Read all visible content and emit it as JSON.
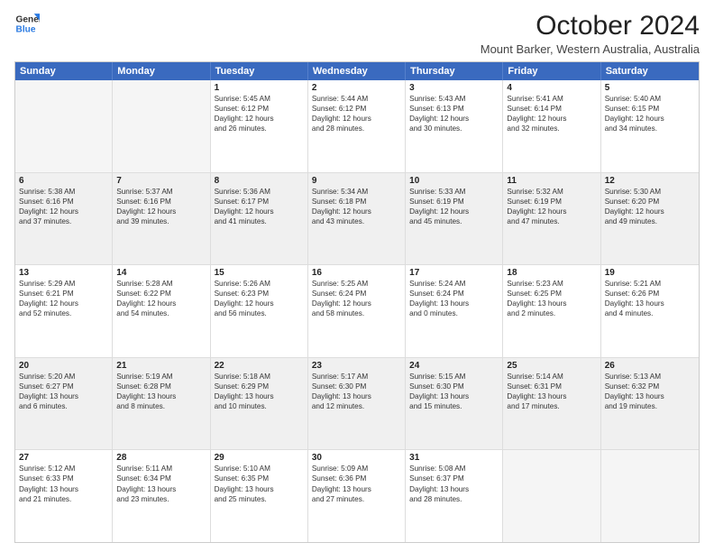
{
  "logo": {
    "line1": "General",
    "line2": "Blue"
  },
  "title": "October 2024",
  "subtitle": "Mount Barker, Western Australia, Australia",
  "headers": [
    "Sunday",
    "Monday",
    "Tuesday",
    "Wednesday",
    "Thursday",
    "Friday",
    "Saturday"
  ],
  "rows": [
    [
      {
        "day": "",
        "lines": [],
        "empty": true
      },
      {
        "day": "",
        "lines": [],
        "empty": true
      },
      {
        "day": "1",
        "lines": [
          "Sunrise: 5:45 AM",
          "Sunset: 6:12 PM",
          "Daylight: 12 hours",
          "and 26 minutes."
        ]
      },
      {
        "day": "2",
        "lines": [
          "Sunrise: 5:44 AM",
          "Sunset: 6:12 PM",
          "Daylight: 12 hours",
          "and 28 minutes."
        ]
      },
      {
        "day": "3",
        "lines": [
          "Sunrise: 5:43 AM",
          "Sunset: 6:13 PM",
          "Daylight: 12 hours",
          "and 30 minutes."
        ]
      },
      {
        "day": "4",
        "lines": [
          "Sunrise: 5:41 AM",
          "Sunset: 6:14 PM",
          "Daylight: 12 hours",
          "and 32 minutes."
        ]
      },
      {
        "day": "5",
        "lines": [
          "Sunrise: 5:40 AM",
          "Sunset: 6:15 PM",
          "Daylight: 12 hours",
          "and 34 minutes."
        ]
      }
    ],
    [
      {
        "day": "6",
        "lines": [
          "Sunrise: 5:38 AM",
          "Sunset: 6:16 PM",
          "Daylight: 12 hours",
          "and 37 minutes."
        ],
        "shaded": true
      },
      {
        "day": "7",
        "lines": [
          "Sunrise: 5:37 AM",
          "Sunset: 6:16 PM",
          "Daylight: 12 hours",
          "and 39 minutes."
        ],
        "shaded": true
      },
      {
        "day": "8",
        "lines": [
          "Sunrise: 5:36 AM",
          "Sunset: 6:17 PM",
          "Daylight: 12 hours",
          "and 41 minutes."
        ],
        "shaded": true
      },
      {
        "day": "9",
        "lines": [
          "Sunrise: 5:34 AM",
          "Sunset: 6:18 PM",
          "Daylight: 12 hours",
          "and 43 minutes."
        ],
        "shaded": true
      },
      {
        "day": "10",
        "lines": [
          "Sunrise: 5:33 AM",
          "Sunset: 6:19 PM",
          "Daylight: 12 hours",
          "and 45 minutes."
        ],
        "shaded": true
      },
      {
        "day": "11",
        "lines": [
          "Sunrise: 5:32 AM",
          "Sunset: 6:19 PM",
          "Daylight: 12 hours",
          "and 47 minutes."
        ],
        "shaded": true
      },
      {
        "day": "12",
        "lines": [
          "Sunrise: 5:30 AM",
          "Sunset: 6:20 PM",
          "Daylight: 12 hours",
          "and 49 minutes."
        ],
        "shaded": true
      }
    ],
    [
      {
        "day": "13",
        "lines": [
          "Sunrise: 5:29 AM",
          "Sunset: 6:21 PM",
          "Daylight: 12 hours",
          "and 52 minutes."
        ]
      },
      {
        "day": "14",
        "lines": [
          "Sunrise: 5:28 AM",
          "Sunset: 6:22 PM",
          "Daylight: 12 hours",
          "and 54 minutes."
        ]
      },
      {
        "day": "15",
        "lines": [
          "Sunrise: 5:26 AM",
          "Sunset: 6:23 PM",
          "Daylight: 12 hours",
          "and 56 minutes."
        ]
      },
      {
        "day": "16",
        "lines": [
          "Sunrise: 5:25 AM",
          "Sunset: 6:24 PM",
          "Daylight: 12 hours",
          "and 58 minutes."
        ]
      },
      {
        "day": "17",
        "lines": [
          "Sunrise: 5:24 AM",
          "Sunset: 6:24 PM",
          "Daylight: 13 hours",
          "and 0 minutes."
        ]
      },
      {
        "day": "18",
        "lines": [
          "Sunrise: 5:23 AM",
          "Sunset: 6:25 PM",
          "Daylight: 13 hours",
          "and 2 minutes."
        ]
      },
      {
        "day": "19",
        "lines": [
          "Sunrise: 5:21 AM",
          "Sunset: 6:26 PM",
          "Daylight: 13 hours",
          "and 4 minutes."
        ]
      }
    ],
    [
      {
        "day": "20",
        "lines": [
          "Sunrise: 5:20 AM",
          "Sunset: 6:27 PM",
          "Daylight: 13 hours",
          "and 6 minutes."
        ],
        "shaded": true
      },
      {
        "day": "21",
        "lines": [
          "Sunrise: 5:19 AM",
          "Sunset: 6:28 PM",
          "Daylight: 13 hours",
          "and 8 minutes."
        ],
        "shaded": true
      },
      {
        "day": "22",
        "lines": [
          "Sunrise: 5:18 AM",
          "Sunset: 6:29 PM",
          "Daylight: 13 hours",
          "and 10 minutes."
        ],
        "shaded": true
      },
      {
        "day": "23",
        "lines": [
          "Sunrise: 5:17 AM",
          "Sunset: 6:30 PM",
          "Daylight: 13 hours",
          "and 12 minutes."
        ],
        "shaded": true
      },
      {
        "day": "24",
        "lines": [
          "Sunrise: 5:15 AM",
          "Sunset: 6:30 PM",
          "Daylight: 13 hours",
          "and 15 minutes."
        ],
        "shaded": true
      },
      {
        "day": "25",
        "lines": [
          "Sunrise: 5:14 AM",
          "Sunset: 6:31 PM",
          "Daylight: 13 hours",
          "and 17 minutes."
        ],
        "shaded": true
      },
      {
        "day": "26",
        "lines": [
          "Sunrise: 5:13 AM",
          "Sunset: 6:32 PM",
          "Daylight: 13 hours",
          "and 19 minutes."
        ],
        "shaded": true
      }
    ],
    [
      {
        "day": "27",
        "lines": [
          "Sunrise: 5:12 AM",
          "Sunset: 6:33 PM",
          "Daylight: 13 hours",
          "and 21 minutes."
        ]
      },
      {
        "day": "28",
        "lines": [
          "Sunrise: 5:11 AM",
          "Sunset: 6:34 PM",
          "Daylight: 13 hours",
          "and 23 minutes."
        ]
      },
      {
        "day": "29",
        "lines": [
          "Sunrise: 5:10 AM",
          "Sunset: 6:35 PM",
          "Daylight: 13 hours",
          "and 25 minutes."
        ]
      },
      {
        "day": "30",
        "lines": [
          "Sunrise: 5:09 AM",
          "Sunset: 6:36 PM",
          "Daylight: 13 hours",
          "and 27 minutes."
        ]
      },
      {
        "day": "31",
        "lines": [
          "Sunrise: 5:08 AM",
          "Sunset: 6:37 PM",
          "Daylight: 13 hours",
          "and 28 minutes."
        ]
      },
      {
        "day": "",
        "lines": [],
        "empty": true
      },
      {
        "day": "",
        "lines": [],
        "empty": true
      }
    ]
  ]
}
